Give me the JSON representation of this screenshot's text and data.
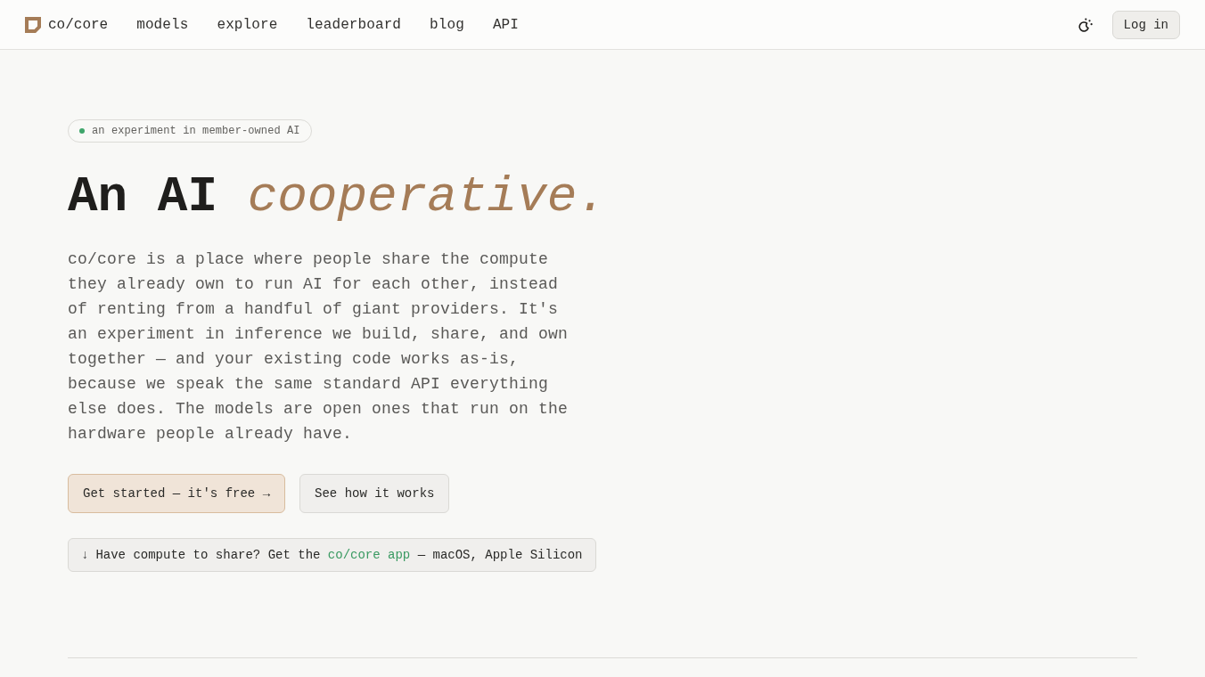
{
  "header": {
    "logo": "co/core",
    "nav": [
      {
        "label": "models"
      },
      {
        "label": "explore"
      },
      {
        "label": "leaderboard"
      },
      {
        "label": "blog"
      },
      {
        "label": "API"
      }
    ],
    "login": "Log in"
  },
  "hero": {
    "badge": "an experiment in member-owned AI",
    "headline": "An AI *cooperative.*",
    "description": "co/core is a place where people share the compute they already own to run AI for each other, instead of renting from a handful of giant providers. It's an experiment in inference we build, share, and own together — and your existing code works as-is, because we speak the same standard API everything else does. The models are open ones that run on the hardware people already have.",
    "buttons": [
      {
        "label": "Get started — it's free →",
        "kind": "primary"
      },
      {
        "label": "See how it works",
        "kind": "secondary"
      }
    ],
    "download": {
      "arrow": "↓",
      "before": "Have compute to share? Get the ",
      "link": "co/core app",
      "after": " — macOS, Apple Silicon"
    }
  }
}
